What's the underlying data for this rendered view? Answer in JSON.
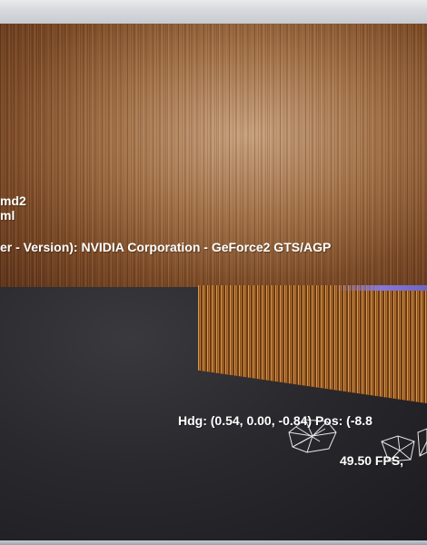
{
  "overlay": {
    "model_line": "md2",
    "config_line": "ml",
    "renderer_line": "er - Version): NVIDIA Corporation - GeForce2 GTS/AGP",
    "heading_line": "Hdg: (0.54, 0.00, -0.84) Pos: (-8.8",
    "fps_line": "49.50 FPS,"
  },
  "colors": {
    "overlay_text": "#ffffff",
    "wireframe": "#e6e6e6",
    "texture_warm": "#a47248",
    "floor": "#2a292d"
  },
  "icons": {
    "wireframe_model": "wireframe-figure"
  }
}
